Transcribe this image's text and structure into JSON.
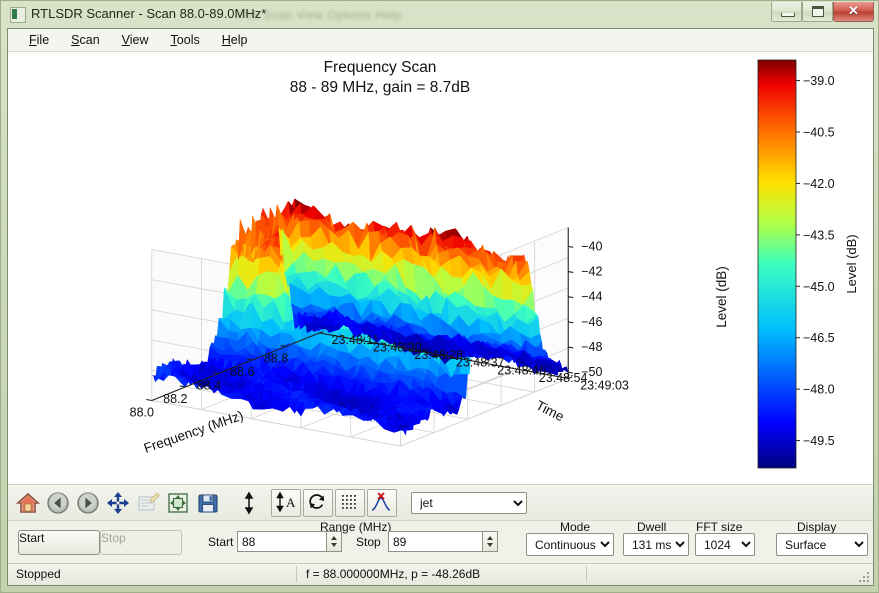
{
  "window": {
    "title": "RTLSDR Scanner - Scan 88.0-89.0MHz*",
    "ghost_title": "File    Scan    View    Options    Help",
    "close_glyph": "✕",
    "icon_name": "app-icon"
  },
  "menu": [
    {
      "pre": "",
      "accel": "F",
      "post": "ile"
    },
    {
      "pre": "",
      "accel": "S",
      "post": "can"
    },
    {
      "pre": "",
      "accel": "V",
      "post": "iew"
    },
    {
      "pre": "",
      "accel": "T",
      "post": "ools"
    },
    {
      "pre": "",
      "accel": "H",
      "post": "elp"
    }
  ],
  "toolbar": {
    "icons": [
      {
        "name": "home-icon",
        "label": "Home"
      },
      {
        "name": "back-arrow-icon",
        "label": "Back"
      },
      {
        "name": "forward-arrow-icon",
        "label": "Forward"
      },
      {
        "name": "pan-move-icon",
        "label": "Pan"
      },
      {
        "name": "configure-subplots-icon",
        "label": "Configure subplots"
      },
      {
        "name": "resize-icon",
        "label": "Resize"
      },
      {
        "name": "save-disk-icon",
        "label": "Save"
      }
    ],
    "buttons": [
      {
        "name": "autoscale-icon",
        "label": "Autoscale"
      },
      {
        "name": "auto-level-icon",
        "label": "Auto level"
      },
      {
        "name": "refresh-cycle-icon",
        "label": "Refresh"
      },
      {
        "name": "grid-dots-icon",
        "label": "Grid"
      },
      {
        "name": "peak-marker-icon",
        "label": "Peak"
      }
    ],
    "colormap": {
      "value": "jet",
      "options": [
        "jet"
      ]
    }
  },
  "controls": {
    "start_button": "Start",
    "stop_button": "Stop",
    "range_group_label": "Range (MHz)",
    "start_label": "Start",
    "start_value": "88",
    "stop_label": "Stop",
    "stop_value": "89",
    "mode_label": "Mode",
    "mode_value": "Continuous",
    "dwell_label": "Dwell",
    "dwell_value": "131 ms",
    "fft_label": "FFT size",
    "fft_value": "1024",
    "display_label": "Display",
    "display_value": "Surface"
  },
  "statusbar": {
    "state": "Stopped",
    "reading": "f = 88.000000MHz, p = -48.26dB"
  },
  "chart_data": {
    "type": "surface",
    "title": "Frequency Scan",
    "subtitle": "88 - 89 MHz, gain = 8.7dB",
    "xlabel": "Frequency (MHz)",
    "ylabel": "Time",
    "zlabel": "Level (dB)",
    "colorbar_label": "Level (dB)",
    "colormap": "jet",
    "grid": true,
    "xticks": [
      "88.0",
      "88.2",
      "88.4",
      "88.6",
      "88.8"
    ],
    "xlim": [
      88.0,
      89.0
    ],
    "yticks": [
      "23:48:11",
      "23:48:20",
      "23:48:28",
      "23:48:37",
      "23:48:46",
      "23:48:54",
      "23:49:03"
    ],
    "zticks": [
      "-40",
      "-42",
      "-44",
      "-46",
      "-48",
      "-50"
    ],
    "zlim": [
      -50.5,
      -38.5
    ],
    "colorbar_ticks": [
      "-39.0",
      "-40.5",
      "-42.0",
      "-43.5",
      "-45.0",
      "-46.5",
      "-48.0",
      "-49.5"
    ],
    "colorbar_range": [
      -50.3,
      -38.4
    ],
    "signal_center_mhz": 88.62,
    "signal_width_mhz": 0.3,
    "signal_peak_db": -38.8,
    "noise_floor_db": -49.6,
    "n_freq_bins": 96,
    "n_time_sweeps": 26,
    "jet_stops": [
      {
        "pos": 0.0,
        "color": "#00007f"
      },
      {
        "pos": 0.11,
        "color": "#0000ff"
      },
      {
        "pos": 0.34,
        "color": "#00bfff"
      },
      {
        "pos": 0.5,
        "color": "#3cffbe"
      },
      {
        "pos": 0.6,
        "color": "#b0ff47"
      },
      {
        "pos": 0.7,
        "color": "#ffe100"
      },
      {
        "pos": 0.84,
        "color": "#ff6200"
      },
      {
        "pos": 0.94,
        "color": "#ee0000"
      },
      {
        "pos": 1.0,
        "color": "#7f0000"
      }
    ]
  }
}
